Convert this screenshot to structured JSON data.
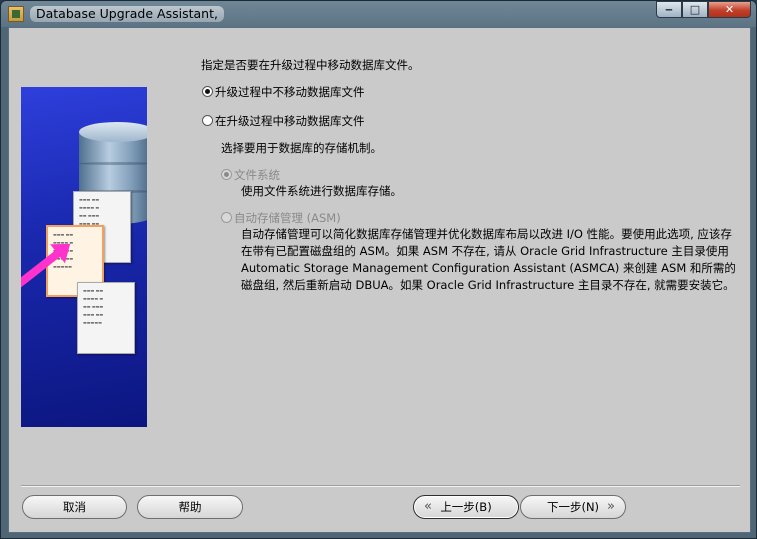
{
  "window": {
    "title": "Database Upgrade Assistant,",
    "minimize_glyph": "‒",
    "maximize_glyph": "□",
    "close_glyph": "✕"
  },
  "main": {
    "prompt": "指定是否要在升级过程中移动数据库文件。",
    "option_no_move": {
      "label": "升级过程中不移动数据库文件",
      "selected": true
    },
    "option_move": {
      "label": "在升级过程中移动数据库文件",
      "selected": false
    },
    "storage_prompt": "选择要用于数据库的存储机制。",
    "storage_fs": {
      "label": "文件系统",
      "description": "使用文件系统进行数据库存储。",
      "selected": true,
      "enabled": false
    },
    "storage_asm": {
      "label": "自动存储管理 (ASM)",
      "description": "自动存储管理可以简化数据库存储管理并优化数据库布局以改进 I/O 性能。要使用此选项, 应该存在带有已配置磁盘组的 ASM。如果 ASM 不存在, 请从 Oracle Grid Infrastructure 主目录使用 Automatic Storage Management Configuration Assistant (ASMCA) 来创建 ASM 和所需的磁盘组, 然后重新启动 DBUA。如果 Oracle Grid Infrastructure 主目录不存在, 就需要安装它。",
      "selected": false,
      "enabled": false
    }
  },
  "footer": {
    "cancel_label": "取消",
    "help_label": "帮助",
    "back_label": "上一步(B)",
    "next_label": "下一步(N)"
  },
  "icons": {
    "back": "chevron-left-double-icon",
    "next": "chevron-right-double-icon"
  }
}
